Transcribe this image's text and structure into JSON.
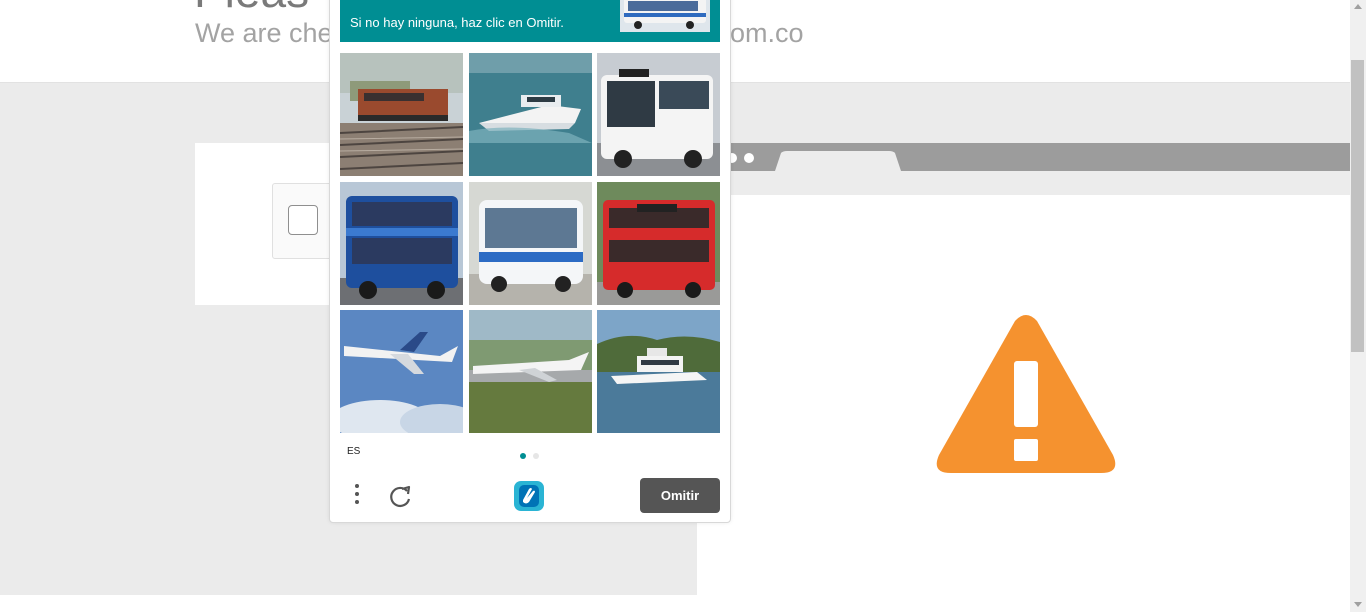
{
  "page": {
    "heading": "Pleas",
    "subtitle_start": "We are che",
    "subtitle_end": "om.co"
  },
  "challenge": {
    "prompt": "Si no hay ninguna, haz clic en Omitir.",
    "prompt_example_image": "bus",
    "tiles": [
      "train",
      "boat",
      "bus",
      "bus",
      "bus",
      "bus",
      "airplane",
      "airplane",
      "boat"
    ],
    "language": "ES",
    "page_count": 2,
    "active_page": 1,
    "skip_label": "Omitir",
    "menu_icon": "more-vertical-icon",
    "refresh_icon": "refresh-icon",
    "logo_icon": "hcaptcha-logo"
  },
  "colors": {
    "prompt_bg": "#008e93",
    "skip_button": "#555555",
    "warning": "#f5922f"
  }
}
